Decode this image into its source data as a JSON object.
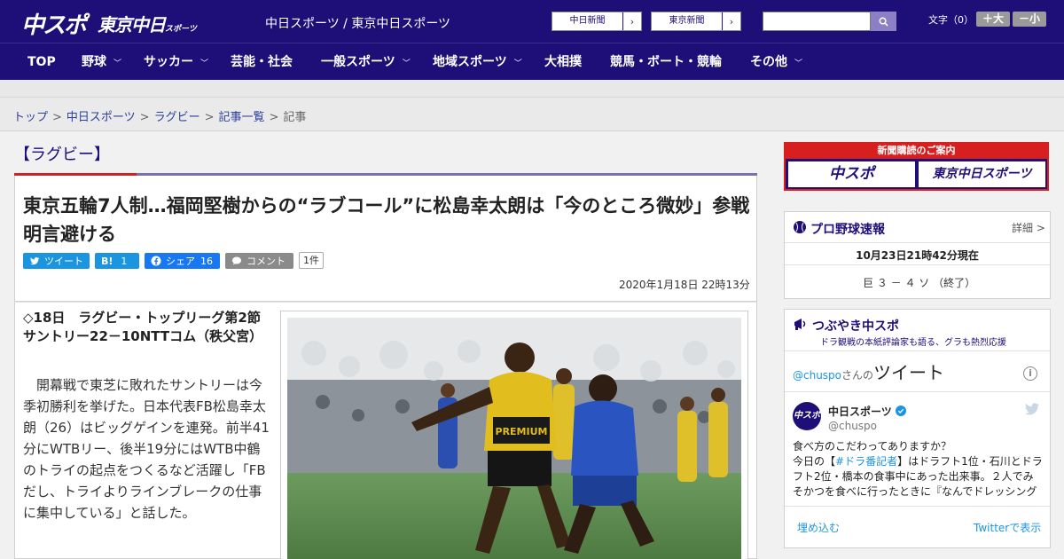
{
  "header": {
    "logo_chuspo": "中スポ",
    "logo_tokyo": "東京中日",
    "logo_tokyo_sub": "スポーツ",
    "site_name": "中日スポーツ / 東京中日スポーツ",
    "ext_links": [
      {
        "label": "中日新聞",
        "arrow": "›"
      },
      {
        "label": "東京新聞",
        "arrow": "›"
      }
    ],
    "search_placeholder": "",
    "fontsize_label": "文字（0）",
    "font_bigger": "＋大",
    "font_smaller": "－小"
  },
  "nav": {
    "items": [
      {
        "label": "TOP",
        "chevron": ""
      },
      {
        "label": "野球",
        "chevron": "﹀"
      },
      {
        "label": "サッカー",
        "chevron": "﹀"
      },
      {
        "label": "芸能・社会",
        "chevron": ""
      },
      {
        "label": "一般スポーツ",
        "chevron": "﹀"
      },
      {
        "label": "地域スポーツ",
        "chevron": "﹀"
      },
      {
        "label": "大相撲",
        "chevron": ""
      },
      {
        "label": "競馬・ボート・競輪",
        "chevron": ""
      },
      {
        "label": "その他",
        "chevron": "﹀"
      }
    ]
  },
  "breadcrumb": {
    "items": [
      "トップ",
      "中日スポーツ",
      "ラグビー",
      "記事一覧"
    ],
    "separator": ">",
    "current": "記事"
  },
  "article": {
    "category": "【ラグビー】",
    "headline": "東京五輪7人制…福岡堅樹からの“ラブコール”に松島幸太朗は「今のところ微妙」参戦明言避ける",
    "share": {
      "tweet": "ツイート",
      "hatena": "B!",
      "hatena_count": "1",
      "facebook": "シェア",
      "facebook_count": "16",
      "comment": "コメント",
      "comment_count": "1件"
    },
    "date": "2020年1月18日 22時13分",
    "lead": "◇18日　ラグビー・トップリーグ第2節　サントリー22－10NTTコム（秩父宮）",
    "body": "開幕戦で東芝に敗れたサントリーは今季初勝利を挙げた。日本代表FB松島幸太朗（26）はビッグゲインを連発。前半41分にWTBリー、後半19分にはWTB中鶴のトライの起点をつくるなど活躍し「FBだし、トライよりラインブレークの仕事に集中している」と話した。",
    "photo_jersey_text": "PREMIUM"
  },
  "sidebar": {
    "subscribe_title": "新聞購読のご案内",
    "subscribe_logos": [
      "中スポ",
      "東京中日スポーツ"
    ],
    "baseball": {
      "title": "プロ野球速報",
      "more": "詳細 >",
      "updated": "10月23日21時42分現在",
      "score": "巨 ３ － ４ ソ （終了）"
    },
    "tsubuyaki": {
      "title": "つぶやき中スポ",
      "subtitle": "ドラ観戦の本紙評論家も語る、グラも熱烈応援",
      "handle_prefix": "@chuspo",
      "handle_suffix": "さんの",
      "tweets_word": "ツイート",
      "info_icon": "i",
      "account_name": "中日スポーツ",
      "account_handle": "@chuspo",
      "avatar_text": "中スポ",
      "tweet_line1": "食べ方のこだわってありますか？",
      "tweet_line2_pre": "今日の【",
      "tweet_tag": "#ドラ番記者",
      "tweet_line2_post": "】はドラフト1位・石川とドラフト2位・橋本の食事中にあった出来事。２人でみそかつを食べに行ったときに『なんでドレッシング",
      "embed": "埋め込む",
      "view_on": "Twitterで表示"
    }
  }
}
